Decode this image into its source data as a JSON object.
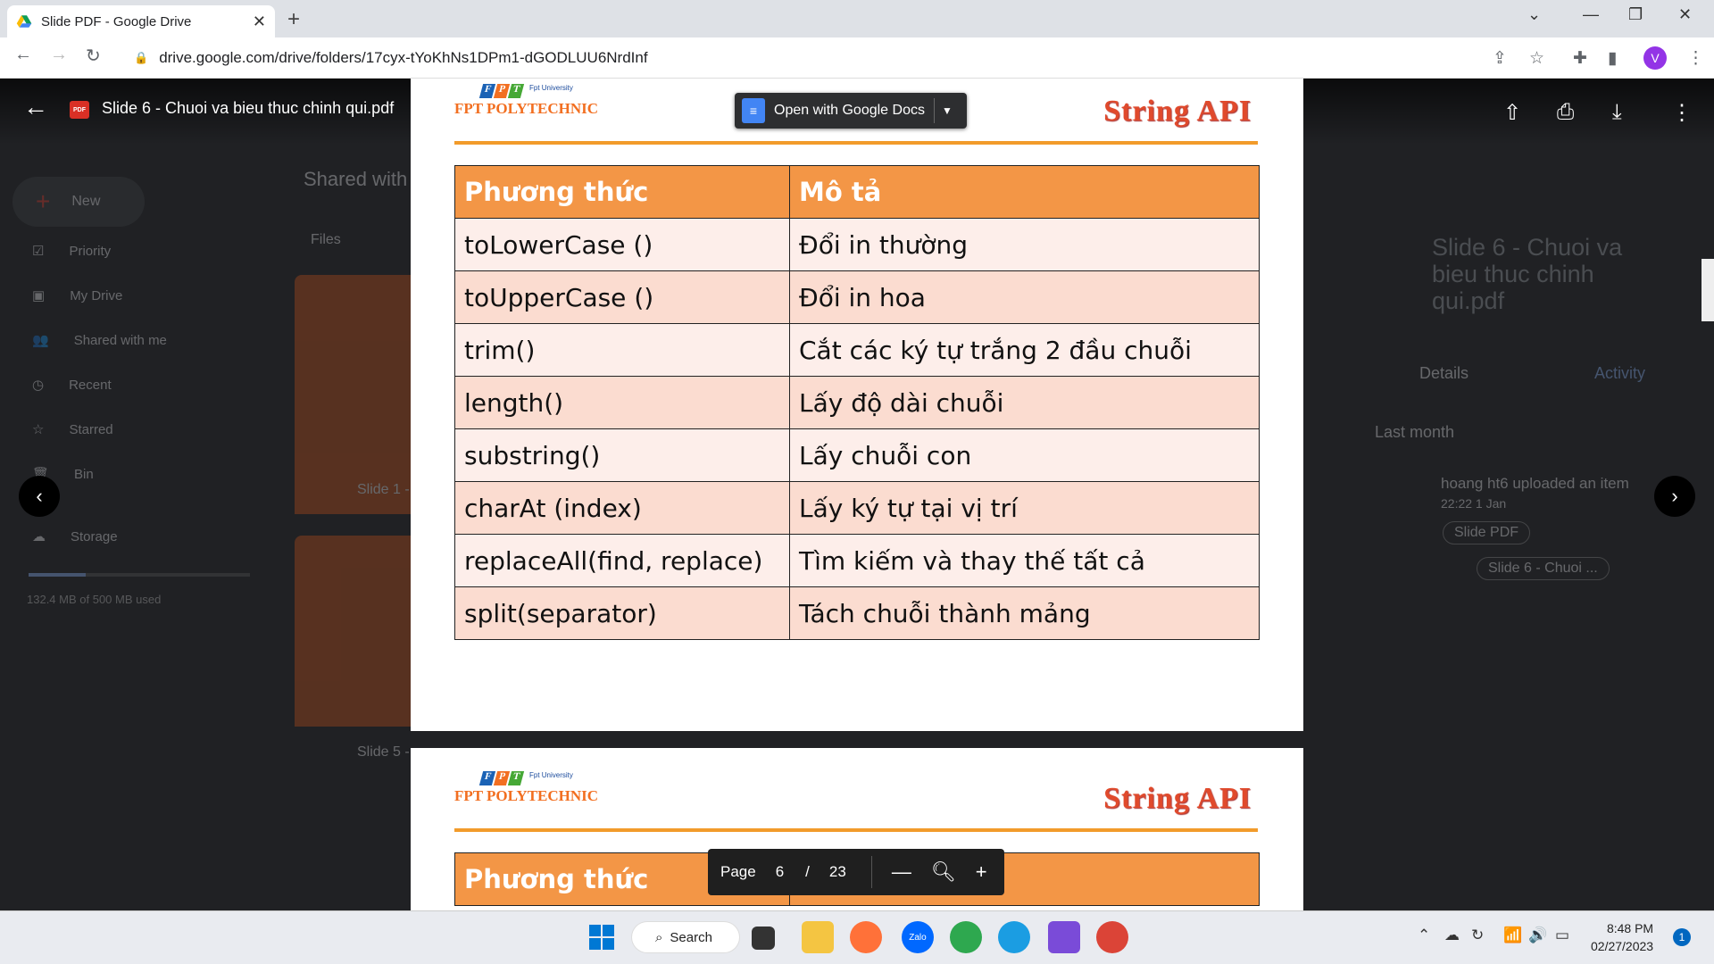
{
  "browser": {
    "tab_title": "Slide PDF - Google Drive",
    "url": "drive.google.com/drive/folders/17cyx-tYoKhNs1DPm1-dGODLUU6NrdInf",
    "profile_initial": "V"
  },
  "drive": {
    "new_label": "New",
    "nav": [
      "Priority",
      "My Drive",
      "Shared with me",
      "Recent",
      "Starred",
      "Bin",
      "Storage"
    ],
    "storage_text": "132.4 MB of 500 MB used",
    "breadcrumb": "Shared with",
    "files_label": "Files",
    "file_cards": [
      "Slide 1 -",
      "Slide 5 -"
    ],
    "details_title": "Slide 6 - Chuoi va bieu thuc chinh qui.pdf",
    "details_tabs": [
      "Details",
      "Activity"
    ],
    "activity_period": "Last month",
    "activity_text": "hoang ht6 uploaded an item",
    "activity_time": "22:22 1 Jan",
    "activity_chips": [
      "Slide PDF",
      "Slide 6 - Chuoi ..."
    ]
  },
  "viewer": {
    "file_name": "Slide 6 - Chuoi va bieu thuc chinh qui.pdf",
    "open_with_label": "Open with Google Docs",
    "page_label": "Page",
    "page_current": "6",
    "page_separator": "/",
    "page_total": "23"
  },
  "slide": {
    "brand": "FPT POLYTECHNIC",
    "brand_small": "Fpt University",
    "title": "String API",
    "headers": [
      "Phương thức",
      "Mô tả"
    ],
    "rows": [
      [
        "toLowerCase ()",
        "Đổi in thường"
      ],
      [
        "toUpperCase ()",
        "Đổi in hoa"
      ],
      [
        "trim()",
        "Cắt các ký tự trắng 2 đầu chuỗi"
      ],
      [
        "length()",
        "Lấy độ dài chuỗi"
      ],
      [
        "substring()",
        "Lấy chuỗi con"
      ],
      [
        "charAt (index)",
        "Lấy ký tự tại vị trí"
      ],
      [
        "replaceAll(find, replace)",
        "Tìm kiếm và thay thế tất cả"
      ],
      [
        "split(separator)",
        "Tách chuỗi thành mảng"
      ]
    ]
  },
  "taskbar": {
    "search_label": "Search",
    "time": "8:48 PM",
    "date": "02/27/2023",
    "notifications": "1"
  }
}
